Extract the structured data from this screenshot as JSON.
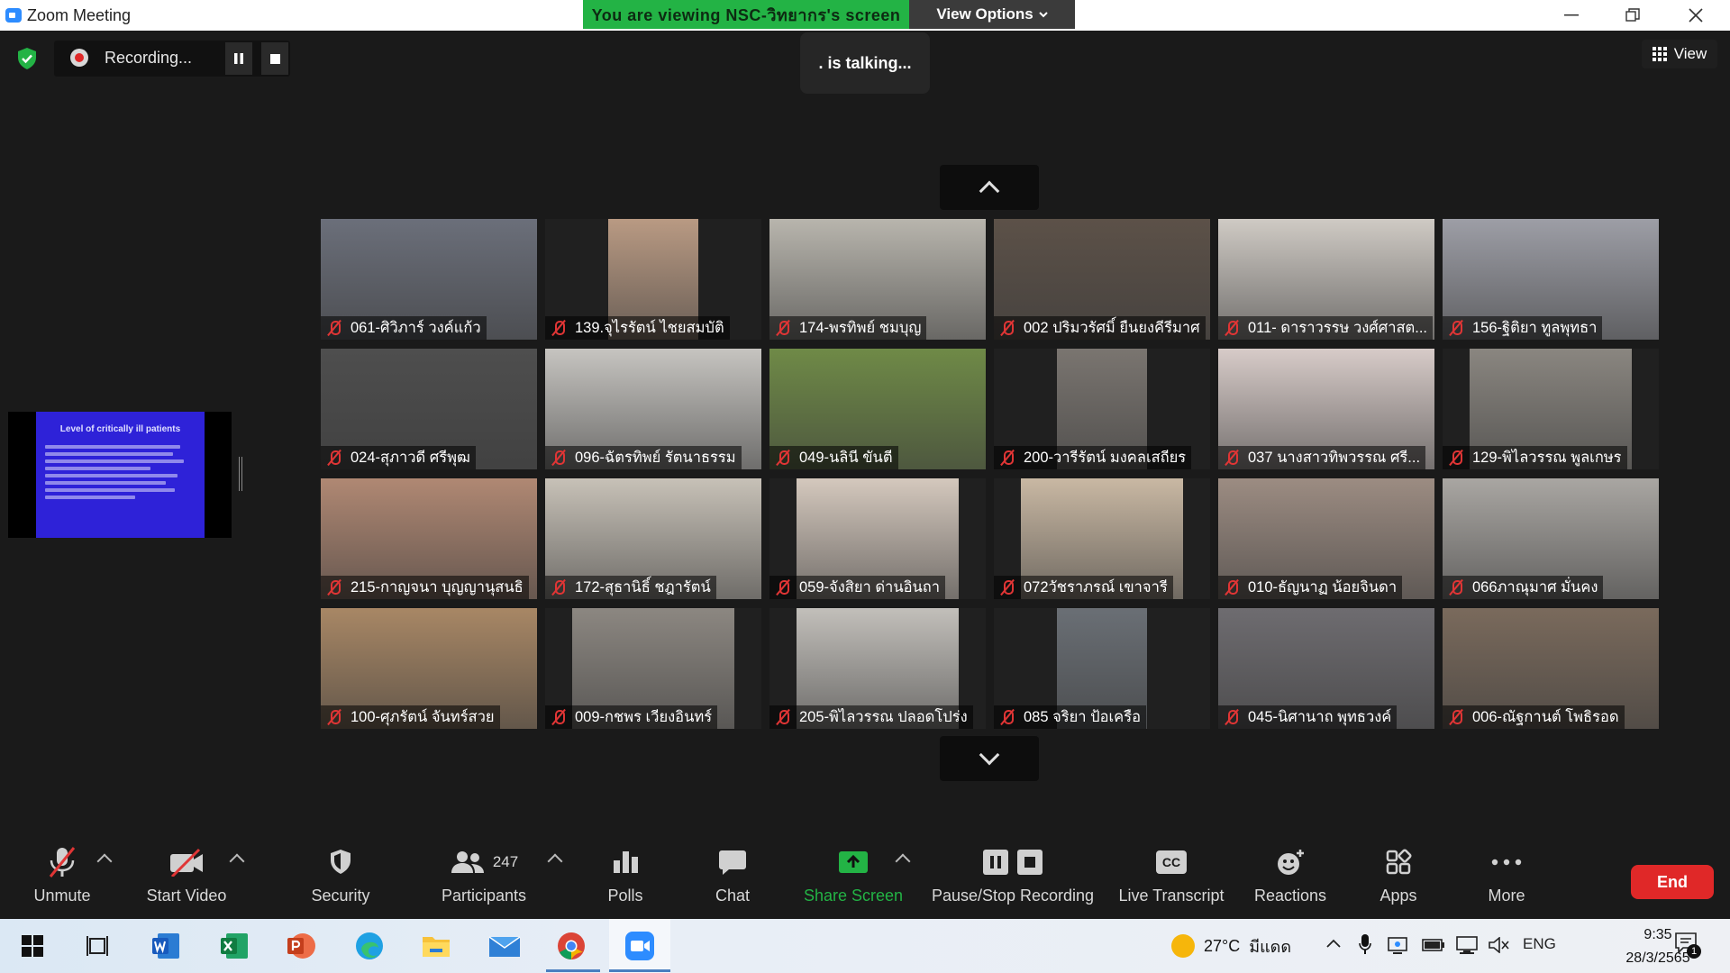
{
  "window": {
    "title": "Zoom Meeting"
  },
  "share_banner": {
    "text": "You are viewing NSC-วิทยากร's screen",
    "view_options": "View Options"
  },
  "recording": {
    "label": "Recording..."
  },
  "talking": {
    "text": ". is talking..."
  },
  "view_button": {
    "label": "View"
  },
  "shared_slide": {
    "title": "Level of critically ill patients"
  },
  "participants": [
    {
      "name": "061-ศิวิภาร์ วงค์แก้ว",
      "bg": "#6b6f7a",
      "w": 240
    },
    {
      "name": "139.จุไรรัตน์ ไชยสมบัติ",
      "bg": "#b99a83",
      "w": 100
    },
    {
      "name": "174-พรทิพย์ ชมบุญ",
      "bg": "#b8b5ad",
      "w": 240
    },
    {
      "name": "002 ปริมวรัศมิ์ ยืนยงคีรีมาศ",
      "bg": "#5c5148",
      "w": 240
    },
    {
      "name": "011- ดาราวรรษ วงศ์ศาสต...",
      "bg": "#cfcac4",
      "w": 240
    },
    {
      "name": "156-ฐิติยา ทูลพุทธา",
      "bg": "#9d9ea6",
      "w": 240
    },
    {
      "name": "024-สุภาวดี ศรีพุฒ",
      "bg": "#4e4e4e",
      "w": 240
    },
    {
      "name": "096-ฉัตรทิพย์ รัตนาธรรม",
      "bg": "#c6c4c0",
      "w": 240
    },
    {
      "name": "049-นลินี ขันตี",
      "bg": "#6f8a47",
      "w": 240
    },
    {
      "name": "200-วารีรัตน์ มงคลเสถียร",
      "bg": "#7a7570",
      "w": 100
    },
    {
      "name": "037 นางสาวทิพวรรณ ศรี...",
      "bg": "#d7cbc8",
      "w": 240
    },
    {
      "name": "129-พิไลวรรณ พูลเกษร",
      "bg": "#8a8680",
      "w": 180
    },
    {
      "name": "215-กาญจนา บุญญานุสนธิ",
      "bg": "#b08873",
      "w": 240
    },
    {
      "name": "172-สุธานิธิ์ ชฎารัตน์",
      "bg": "#c7c1b7",
      "w": 240
    },
    {
      "name": "059-จังสิยา ด่านอินถา",
      "bg": "#d4c8bd",
      "w": 180
    },
    {
      "name": "072วัชราภรณ์ เขาจารี",
      "bg": "#c9b8a3",
      "w": 180
    },
    {
      "name": "010-ธัญนาฏ น้อยจินดา",
      "bg": "#9c8c82",
      "w": 240
    },
    {
      "name": "066ภาณุมาศ มั่นคง",
      "bg": "#a9a6a2",
      "w": 240
    },
    {
      "name": "100-ศุภรัตน์ จันทร์สวย",
      "bg": "#a88765",
      "w": 240
    },
    {
      "name": "009-กชพร เวียงอินทร์",
      "bg": "#8c8781",
      "w": 180
    },
    {
      "name": "205-พิไลวรรณ ปลอดโปร่ง",
      "bg": "#c2bfba",
      "w": 180
    },
    {
      "name": "085 จริยา ป้อเครือ",
      "bg": "#6a6f75",
      "w": 100
    },
    {
      "name": "045-นิศานาถ พุทธวงค์",
      "bg": "#6e6c70",
      "w": 240
    },
    {
      "name": "006-ณัฐกานต์ โพธิรอด",
      "bg": "#7a6a5c",
      "w": 240
    }
  ],
  "toolbar": {
    "unmute": "Unmute",
    "start_video": "Start Video",
    "security": "Security",
    "participants": "Participants",
    "participants_count": "247",
    "polls": "Polls",
    "chat": "Chat",
    "share_screen": "Share Screen",
    "pause_recording": "Pause/Stop Recording",
    "live_transcript": "Live Transcript",
    "live_transcript_icon_text": "CC",
    "reactions": "Reactions",
    "apps": "Apps",
    "more": "More",
    "end": "End"
  },
  "taskbar": {
    "temperature": "27°C",
    "weather": "มีแดด",
    "language": "ENG",
    "time": "9:35",
    "date": "28/3/2565",
    "notifications": "1"
  },
  "colors": {
    "share_green": "#23b345",
    "end_red": "#e02828",
    "accent_blue": "#2d8cff"
  }
}
